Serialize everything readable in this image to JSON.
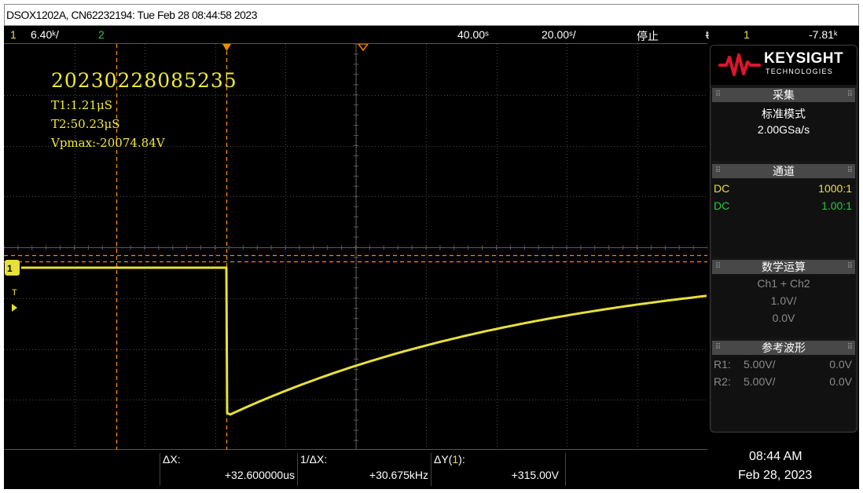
{
  "title_bar": {
    "text": "DSOX1202A, CN62232194: Tue Feb 28 08:44:58 2023"
  },
  "status": {
    "ch1_num": "1",
    "ch1_scale": "6.40ᵏ/",
    "ch2_num": "2",
    "trigger_delay": "40.00ˢ",
    "timebase": "20.00ˢ/",
    "run_state": "停止",
    "trigger_icon": "ᵵ",
    "trigger_ch": "1",
    "trigger_level": "-7.81ᵏ"
  },
  "overlay": {
    "timestamp": "20230228085235",
    "t1": "T1:1.21μS",
    "t2": "T2:50.23μS",
    "vpmax": "Vpmax:-20074.84V"
  },
  "markers": {
    "ch1": "1",
    "trigger": "T"
  },
  "side_panel": {
    "brand": "KEYSIGHT",
    "brand_sub": "TECHNOLOGIES",
    "acquire": {
      "header": "采集",
      "mode": "标准模式",
      "rate": "2.00GSa/s"
    },
    "channels": {
      "header": "通道",
      "rows": [
        {
          "coupling": "DC",
          "probe": "1000:1",
          "color": "#e8e03a"
        },
        {
          "coupling": "DC",
          "probe": "1.00:1",
          "color": "#27c93f"
        }
      ]
    },
    "math": {
      "header": "数学运算",
      "expr": "Ch1 + Ch2",
      "scale": "1.0V/",
      "offset": "0.0V"
    },
    "ref": {
      "header": "参考波形",
      "rows": [
        {
          "name": "R1:",
          "scale": "5.00V/",
          "offset": "0.0V"
        },
        {
          "name": "R2:",
          "scale": "5.00V/",
          "offset": "0.0V"
        }
      ]
    }
  },
  "bottom": {
    "dx_label": "ΔX:",
    "dx_value": "+32.600000us",
    "inv_dx_label": "1/ΔX:",
    "inv_dx_value": "+30.675kHz",
    "dy_label_pre": "ΔY(",
    "dy_label_ch": "1",
    "dy_label_post": "):",
    "dy_value": "+315.00V",
    "clock_time": "08:44 AM",
    "clock_date": "Feb 28, 2023"
  },
  "colors": {
    "ch1": "#e8e03a",
    "ch2": "#27c93f",
    "cursor": "#f08a00",
    "grid": "#4a4a4a"
  }
}
